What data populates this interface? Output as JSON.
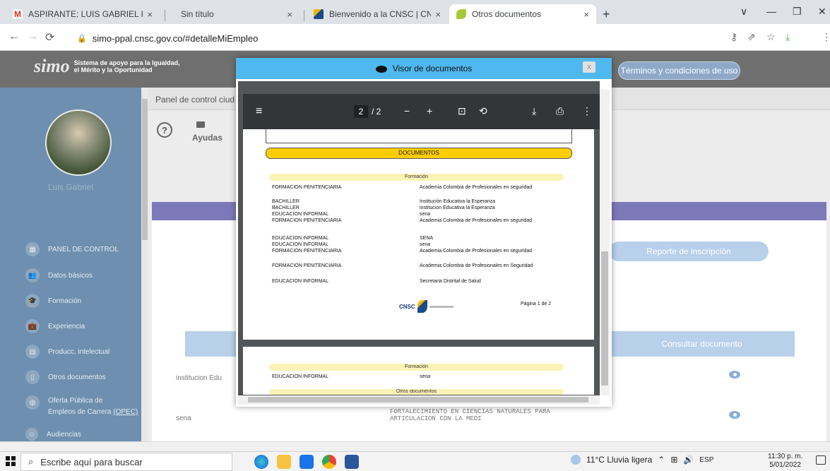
{
  "browser": {
    "tabs": [
      {
        "label": "ASPIRANTE: LUIS GABRIEL PEREZ",
        "close": "×"
      },
      {
        "label": "Sin título",
        "close": "×"
      },
      {
        "label": "Bienvenido a la CNSC | CNSC",
        "close": "×"
      },
      {
        "label": "Otros documentos",
        "close": "×"
      }
    ],
    "new_tab": "+",
    "url": "simo-ppal.cnsc.gov.co/#detalleMiEmpleo",
    "window": {
      "minimize": "—",
      "restore": "❐",
      "close": "✕",
      "chevron": "∨"
    }
  },
  "site": {
    "logo_text": "simo",
    "tagline_1": "Sistema de apoyo para la Igualdad,",
    "tagline_2": "el Mérito y la Oportunidad",
    "terms": "Términos y condiciones de uso"
  },
  "sidebar": {
    "user": "Luis Gabriel",
    "items": [
      {
        "label": "PANEL DE CONTROL",
        "icon": "grid-icon"
      },
      {
        "label": "Datos básicos",
        "icon": "people-icon"
      },
      {
        "label": "Formación",
        "icon": "graduation-icon"
      },
      {
        "label": "Experiencia",
        "icon": "briefcase-icon"
      },
      {
        "label": "Producc. intelectual",
        "icon": "book-icon"
      },
      {
        "label": "Otros documentos",
        "icon": "document-icon"
      },
      {
        "label": "Oferta Pública de",
        "label2": "Empleos de Carrera",
        "label3": "(OPEC)",
        "icon": "globe-icon"
      },
      {
        "label": "Audiencias",
        "icon": "audience-icon"
      }
    ]
  },
  "main": {
    "panel_title": "Panel de control ciud",
    "help": "?",
    "ayudas": "Ayudas",
    "report_button": "Reporte de inscripción",
    "consult_header": "Consultar documento",
    "rows": [
      {
        "col1": "institucion Edu",
        "col2": ""
      },
      {
        "col1": "sena",
        "col2": "FORTALECIMIENTO EN CIENCIAS NATURALES PARA",
        "col2b": "ARTICULACION CON LA MEDI"
      }
    ]
  },
  "modal": {
    "title": "Visor de documentos",
    "close": "x",
    "pdf": {
      "page_current": "2",
      "page_total": "/ 2",
      "docs_header": "DOCUMENTOS",
      "section_formacion": "Formación",
      "entries": [
        [
          "FORMACION PENITENCIARIA",
          "Academia Colombia de Profesionales en seguridad"
        ],
        [
          "BACHILLER",
          "Institución Educativa la Esperanza"
        ],
        [
          "BACHILLER",
          "institucion Educativa la Esperanza"
        ],
        [
          "EDUCACION INFORMAL",
          "sena"
        ],
        [
          "FORMACION PENITENCIARIA",
          "Academia Colombia de Profesionales en seguridad"
        ],
        [
          "EDUCACION INFORMAL",
          "SENA"
        ],
        [
          "EDUCACION INFORMAL",
          "sena"
        ],
        [
          "FORMACION PENITENCIARIA",
          "Academia Colombia de Profesionales en seguridad"
        ],
        [
          "FORMACION PENITENCIARIA",
          "Academia Colombia de Profesionales en Seguridad"
        ],
        [
          "EDUCACION INFORMAL",
          "Secretaria Distrital de Salud"
        ]
      ],
      "cnsc": "CNSC",
      "page_label": "Página 1 de 2",
      "page2_section": "Formación",
      "page2_entry": [
        "EDUCACION INFORMAL",
        "sena"
      ],
      "page2_section2": "Otros documentos"
    }
  },
  "taskbar": {
    "search": "Escribe aquí para buscar",
    "weather": "11°C  Lluvia ligera",
    "lang": "ESP",
    "time": "11:30 p. m.",
    "date": "5/01/2022"
  }
}
